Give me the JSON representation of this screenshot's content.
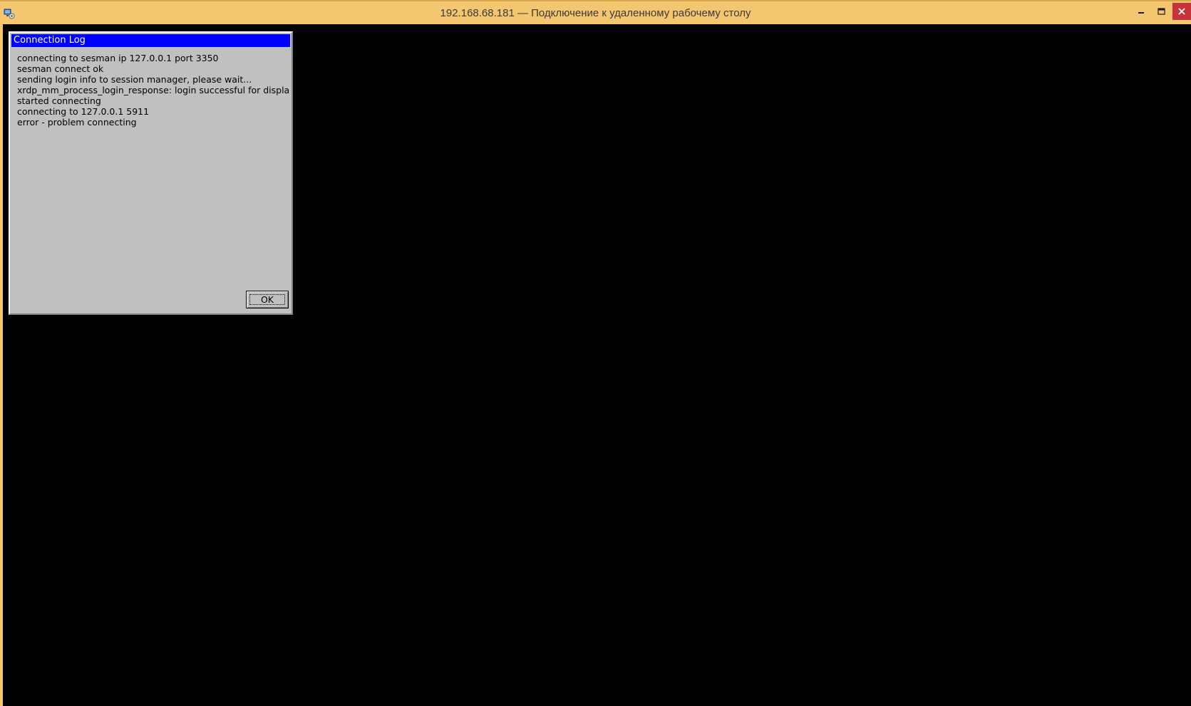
{
  "window": {
    "title": "192.168.68.181 — Подключение к удаленному рабочему столу",
    "icon": "remote-desktop-icon",
    "controls": {
      "minimize": "minimize-icon",
      "maximize": "maximize-icon",
      "close": "close-icon"
    },
    "colors": {
      "titlebar": "#f3c66f",
      "close_button": "#c7343b",
      "remote_background": "#000000"
    }
  },
  "dialog": {
    "title": "Connection Log",
    "lines": [
      "connecting to sesman ip 127.0.0.1 port 3350",
      "sesman connect ok",
      "sending login info to session manager, please wait...",
      "xrdp_mm_process_login_response: login successful for displa",
      "started connecting",
      "connecting to 127.0.0.1 5911",
      "error - problem connecting"
    ],
    "ok_label": "OK",
    "colors": {
      "title_bar": "#0000ff",
      "body": "#c0c0c0"
    }
  }
}
